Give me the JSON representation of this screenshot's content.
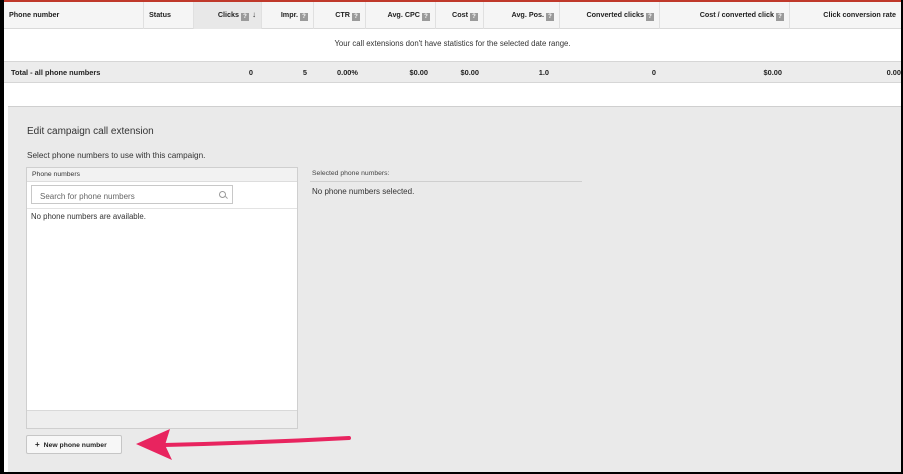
{
  "table": {
    "columns": [
      {
        "label": "Phone number",
        "help": false
      },
      {
        "label": "Status",
        "help": false
      },
      {
        "label": "Clicks",
        "help": true,
        "sorted": true,
        "sort_icon": "↓"
      },
      {
        "label": "Impr.",
        "help": true
      },
      {
        "label": "CTR",
        "help": true
      },
      {
        "label": "Avg. CPC",
        "help": true
      },
      {
        "label": "Cost",
        "help": true
      },
      {
        "label": "Avg. Pos.",
        "help": true
      },
      {
        "label": "Converted clicks",
        "help": true
      },
      {
        "label": "Cost / converted click",
        "help": true
      },
      {
        "label": "Click conversion rate",
        "help": true
      }
    ],
    "help_glyph": "?",
    "empty_message": "Your call extensions don't have statistics for the selected date range.",
    "total_row": {
      "label": "Total - all phone numbers",
      "clicks": "0",
      "impr": "5",
      "ctr": "0.00%",
      "avg_cpc": "$0.00",
      "cost": "$0.00",
      "avg_pos": "1.0",
      "converted_clicks": "0",
      "cost_per_conv": "$0.00",
      "conv_rate": "0.00"
    }
  },
  "edit_panel": {
    "title": "Edit campaign call extension",
    "subtitle": "Select phone numbers to use with this campaign.",
    "phone_numbers": {
      "header": "Phone numbers",
      "search_placeholder": "Search for phone numbers",
      "empty": "No phone numbers are available."
    },
    "selected": {
      "label": "Selected phone numbers:",
      "empty": "No phone numbers selected."
    },
    "new_button": {
      "icon": "+",
      "label": "New phone number"
    }
  },
  "annotation": {
    "arrow_color": "#e8245f"
  },
  "colors": {
    "accent_border": "#c0392b",
    "panel_bg": "#eaeaea"
  }
}
